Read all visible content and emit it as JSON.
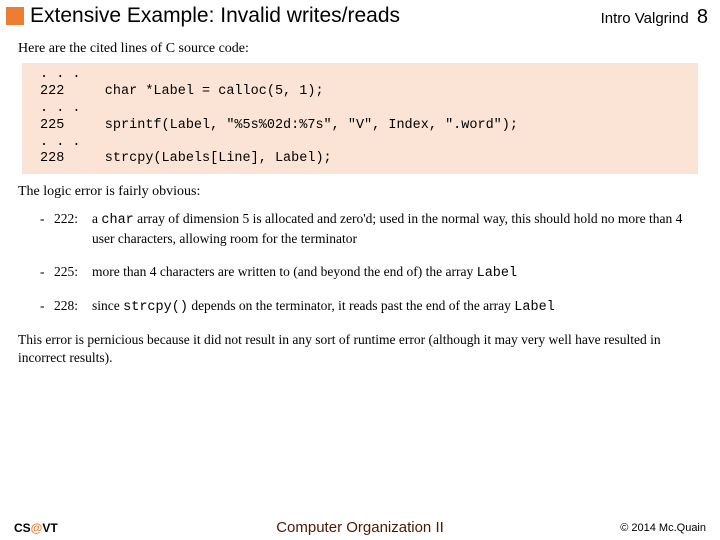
{
  "header": {
    "title": "Extensive Example: Invalid writes/reads",
    "right_label": "Intro Valgrind",
    "page_number": "8"
  },
  "intro": "Here are the cited lines of C source code:",
  "code": ". . .\n222     char *Label = calloc(5, 1);\n. . .\n225     sprintf(Label, \"%5s%02d:%7s\", \"V\", Index, \".word\");\n. . .\n228     strcpy(Labels[Line], Label);",
  "logic_line": "The logic error is fairly obvious:",
  "bullets": [
    {
      "line": "222:",
      "pre": "a ",
      "code1": "char",
      "post1": " array of dimension 5 is allocated and zero'd; used in the normal way, this should hold no more than 4 user characters, allowing room for the terminator"
    },
    {
      "line": "225:",
      "pre": "more than 4 characters are written to (and beyond the end of) the array ",
      "code1": "Label",
      "post1": ""
    },
    {
      "line": "228:",
      "pre": "since ",
      "code1": "strcpy()",
      "post1": " depends on the terminator, it reads past the end of the array ",
      "code2": "Label"
    }
  ],
  "closing": "This error is pernicious because it did not result in any sort of runtime error (although it may very well have resulted in incorrect results).",
  "footer": {
    "left_cs": "CS",
    "left_at": "@",
    "left_vt": "VT",
    "center": "Computer Organization II",
    "right": "© 2014 Mc.Quain"
  }
}
